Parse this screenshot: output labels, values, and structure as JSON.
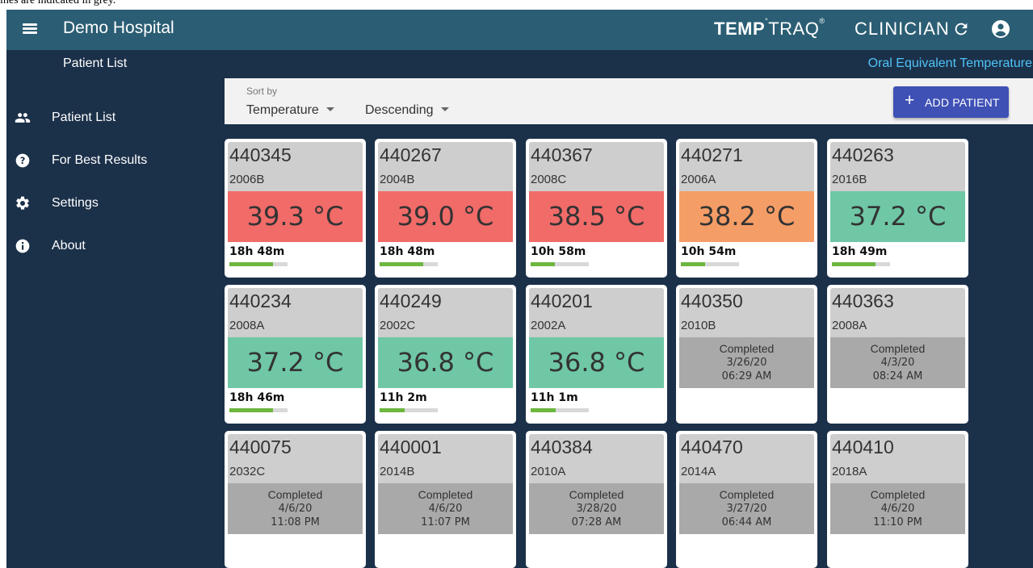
{
  "caption": "ines are indicated in grey.",
  "header": {
    "hospital": "Demo Hospital",
    "logo_bold": "TEMP",
    "logo_light": "TRAQ",
    "logo_sup": "®",
    "logo_sub": "CLINICIAN",
    "menu_icon": "hamburger-menu-icon",
    "refresh_icon": "refresh-icon",
    "account_icon": "account-circle-icon"
  },
  "subheader": {
    "title": "Patient List",
    "temp_mode": "Oral Equivalent Temperature"
  },
  "sidebar": {
    "items": [
      {
        "label": "Patient List",
        "icon": "people-icon"
      },
      {
        "label": "For Best Results",
        "icon": "help-circle-icon"
      },
      {
        "label": "Settings",
        "icon": "gear-icon"
      },
      {
        "label": "About",
        "icon": "info-icon"
      }
    ]
  },
  "sort": {
    "label": "Sort by",
    "field": "Temperature",
    "order": "Descending",
    "add_button": "ADD PATIENT",
    "add_icon": "plus-icon"
  },
  "colors": {
    "red": "#f16b69",
    "orange": "#f59d66",
    "green": "#6fc7a6",
    "completed": "#a9a9a9",
    "progress": "#6db63f"
  },
  "cards": [
    {
      "id": "440345",
      "room": "2006B",
      "temp": "39.3 °C",
      "status": "red",
      "duration": "18h 48m",
      "progress": 0.75
    },
    {
      "id": "440267",
      "room": "2004B",
      "temp": "39.0 °C",
      "status": "red",
      "duration": "18h 48m",
      "progress": 0.75
    },
    {
      "id": "440367",
      "room": "2008C",
      "temp": "38.5 °C",
      "status": "red",
      "duration": "10h 58m",
      "progress": 0.42
    },
    {
      "id": "440271",
      "room": "2006A",
      "temp": "38.2 °C",
      "status": "orange",
      "duration": "10h 54m",
      "progress": 0.42
    },
    {
      "id": "440263",
      "room": "2016B",
      "temp": "37.2 °C",
      "status": "green",
      "duration": "18h 49m",
      "progress": 0.75
    },
    {
      "id": "440234",
      "room": "2008A",
      "temp": "37.2 °C",
      "status": "green",
      "duration": "18h 46m",
      "progress": 0.75
    },
    {
      "id": "440249",
      "room": "2002C",
      "temp": "36.8 °C",
      "status": "green",
      "duration": "11h 2m",
      "progress": 0.43
    },
    {
      "id": "440201",
      "room": "2002A",
      "temp": "36.8 °C",
      "status": "green",
      "duration": "11h 1m",
      "progress": 0.43
    },
    {
      "id": "440350",
      "room": "2010B",
      "status": "completed",
      "completed": "Completed",
      "date": "3/26/20",
      "time": "06:29 AM"
    },
    {
      "id": "440363",
      "room": "2008A",
      "status": "completed",
      "completed": "Completed",
      "date": "4/3/20",
      "time": "08:24 AM"
    },
    {
      "id": "440075",
      "room": "2032C",
      "status": "completed",
      "completed": "Completed",
      "date": "4/6/20",
      "time": "11:08 PM"
    },
    {
      "id": "440001",
      "room": "2014B",
      "status": "completed",
      "completed": "Completed",
      "date": "4/6/20",
      "time": "11:07 PM"
    },
    {
      "id": "440384",
      "room": "2010A",
      "status": "completed",
      "completed": "Completed",
      "date": "3/28/20",
      "time": "07:28 AM"
    },
    {
      "id": "440470",
      "room": "2014A",
      "status": "completed",
      "completed": "Completed",
      "date": "3/27/20",
      "time": "06:44 AM"
    },
    {
      "id": "440410",
      "room": "2018A",
      "status": "completed",
      "completed": "Completed",
      "date": "4/6/20",
      "time": "11:10 PM"
    }
  ]
}
